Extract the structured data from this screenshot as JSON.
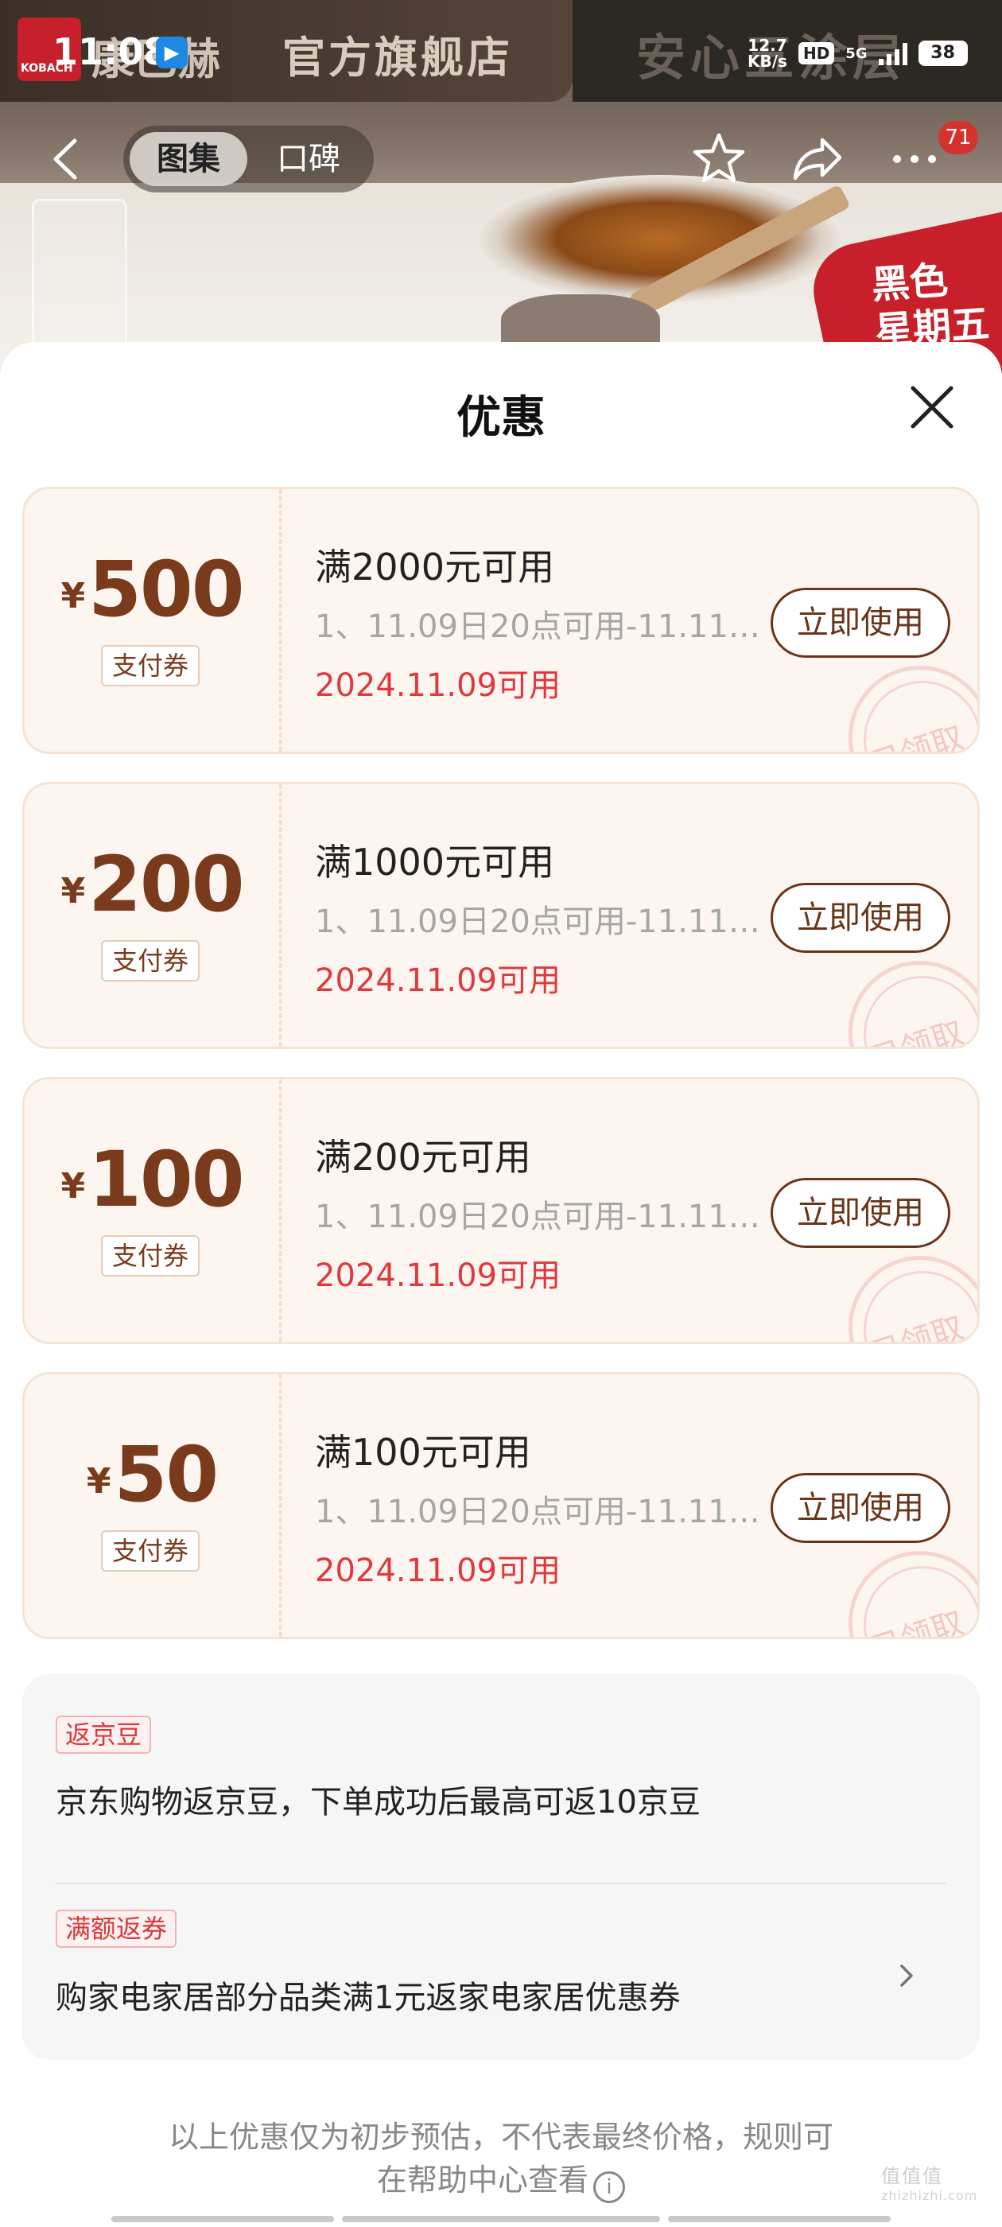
{
  "status_bar": {
    "time": "11:08",
    "net_speed_top": "12.7",
    "net_speed_bottom": "KB/s",
    "hd": "HD",
    "signal": "5G",
    "battery": "38"
  },
  "hero": {
    "brand_logo": "KOBACH",
    "brand_text": "康巴赫",
    "banner_text": "官方旗舰店",
    "right_text": "安心五涂层",
    "tag_line1": "黑色",
    "tag_line2": "星期五"
  },
  "nav": {
    "tab_gallery": "图集",
    "tab_reviews": "口碑",
    "badge": "71"
  },
  "sheet": {
    "title": "优惠"
  },
  "coupons": [
    {
      "currency": "¥",
      "amount": "500",
      "type": "支付券",
      "condition": "满2000元可用",
      "desc": "1、11.09日20点可用-11.11日...",
      "date": "2024.11.09可用",
      "button": "立即使用",
      "stamp": "已领取"
    },
    {
      "currency": "¥",
      "amount": "200",
      "type": "支付券",
      "condition": "满1000元可用",
      "desc": "1、11.09日20点可用-11.11日...",
      "date": "2024.11.09可用",
      "button": "立即使用",
      "stamp": "已领取"
    },
    {
      "currency": "¥",
      "amount": "100",
      "type": "支付券",
      "condition": "满200元可用",
      "desc": "1、11.09日20点可用-11.11日...",
      "date": "2024.11.09可用",
      "button": "立即使用",
      "stamp": "已领取"
    },
    {
      "currency": "¥",
      "amount": "50",
      "type": "支付券",
      "condition": "满100元可用",
      "desc": "1、11.09日20点可用-11.11日...",
      "date": "2024.11.09可用",
      "button": "立即使用",
      "stamp": "已领取"
    }
  ],
  "info": {
    "tag1": "返京豆",
    "text1": "京东购物返京豆，下单成功后最高可返10京豆",
    "tag2": "满额返券",
    "text2": "购家电家居部分品类满1元返家电家居优惠券"
  },
  "disclaimer": {
    "line1": "以上优惠仅为初步预估，不代表最终价格，规则可",
    "line2": "在帮助中心查看"
  },
  "watermark": {
    "text": "值值值",
    "sub": "zhizhizhi.com"
  },
  "colors": {
    "amount": "#7a3a1c",
    "date_red": "#e0383e",
    "coupon_bg": "#fdf6f0",
    "badge_red": "#d4322c"
  }
}
